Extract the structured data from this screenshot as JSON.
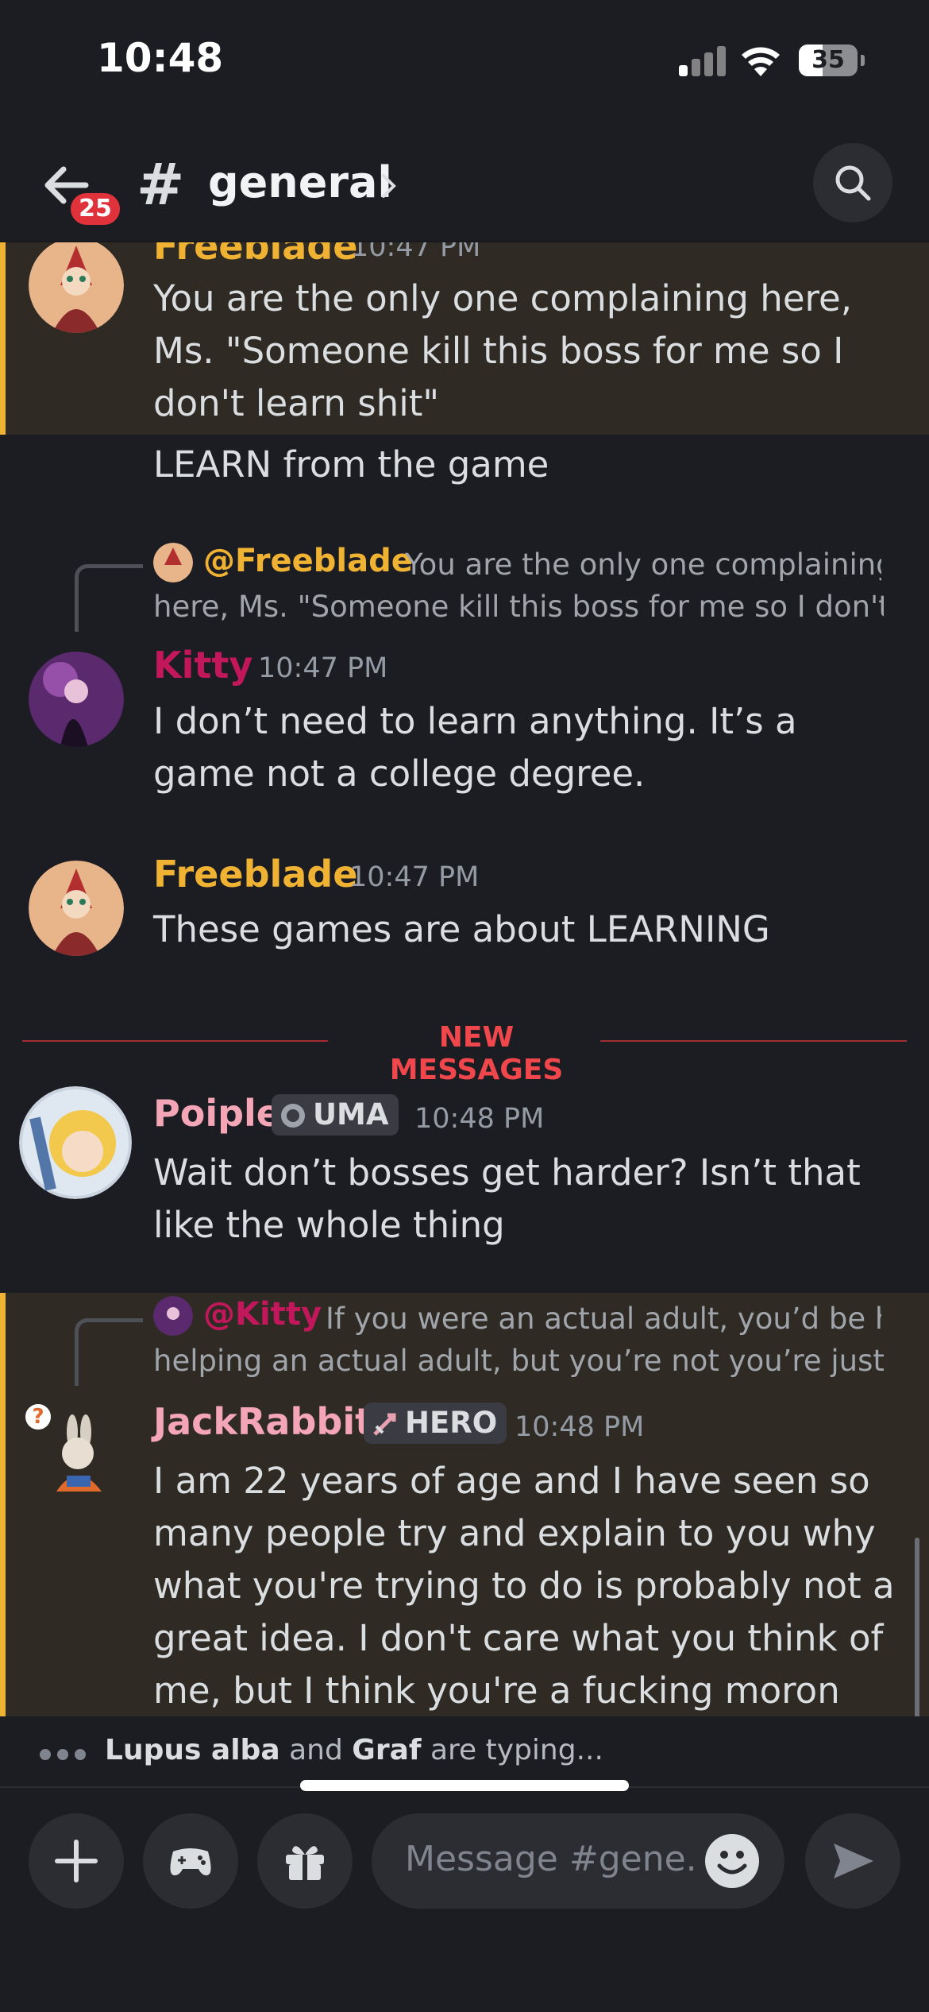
{
  "status_bar": {
    "time": "10:48",
    "battery": "35"
  },
  "header": {
    "badge": "25",
    "hash": "#",
    "channel": "general"
  },
  "messages": [
    {
      "author": "Freeblade",
      "time": "10:47 PM",
      "text": "You are the only one complaining here, Ms. \"Someone kill this boss for me so I don't learn shit\""
    },
    {
      "text": "LEARN from the game"
    },
    {
      "reply_to": "@Freeblade",
      "reply_text": "You are the only one complaining here, Ms. \"Someone kill this boss for me so I don't …",
      "author": "Kitty",
      "time": "10:47 PM",
      "text": "I don’t need to learn anything. It’s a game not a college degree."
    },
    {
      "author": "Freeblade",
      "time": "10:47 PM",
      "text": "These games are about LEARNING"
    },
    {
      "author": "Poiple",
      "tag": "UMA",
      "time": "10:48 PM",
      "text": "Wait don’t bosses get harder? Isn’t that like the whole thing"
    },
    {
      "reply_to": "@Kitty",
      "reply_text": "If you were an actual adult, you’d be helping an actual adult, but you’re not you’re just …",
      "author": "JackRabbit",
      "tag": "HERO",
      "time": "10:48 PM",
      "text": "I am 22 years of age and I have seen so many people try and explain to you why what you're trying to do is probably not a great idea. I don't care what you think of me, but I think you're a fucking moron"
    }
  ],
  "divider": "NEW MESSAGES",
  "typing": {
    "user1": "Lupus alba",
    "and": "and",
    "user2": "Graf",
    "suffix": "are typing..."
  },
  "composer": {
    "placeholder": "Message #gene..."
  },
  "colors": {
    "freeblade": "#f0b232",
    "kitty": "#c2185b",
    "poiple": "#f4a6b7",
    "jackrabbit": "#f4a6b7",
    "mention": "#f0b232",
    "mention_kitty": "#c2185b",
    "new_messages": "#f0474c"
  }
}
